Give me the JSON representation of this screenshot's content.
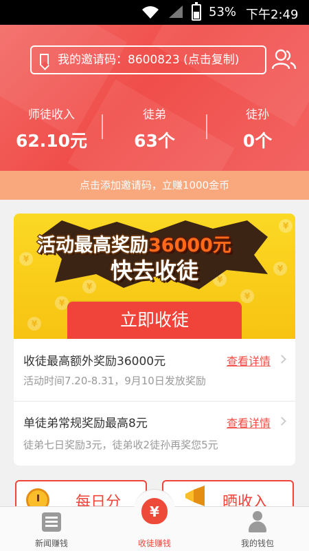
{
  "status_bar": {
    "battery": "53%",
    "time": "下午2:49"
  },
  "header": {
    "invite_text": "我的邀请码：8600823 (点击复制)",
    "stats": [
      {
        "label": "师徒收入",
        "value": "62.10元"
      },
      {
        "label": "徒弟",
        "value": "63个"
      },
      {
        "label": "徒孙",
        "value": "0个"
      }
    ],
    "promo": "点击添加邀请码，立赚1000金币"
  },
  "banner": {
    "line1_prefix": "活动最高奖励",
    "line1_amount": "36000元",
    "line2": "快去收徒",
    "button": "立即收徒"
  },
  "rewards": [
    {
      "title": "收徒最高额外奖励36000元",
      "subtitle": "活动时间7.20-8.31，9月10日发放奖励",
      "link": "查看详情"
    },
    {
      "title": "单徒弟常规奖励最高8元",
      "subtitle": "徒弟七日奖励3元，徒弟收2徒孙再奖您5元",
      "link": "查看详情"
    }
  ],
  "bottom_cards": [
    {
      "label": "每日分"
    },
    {
      "label": "晒收入"
    }
  ],
  "tabs": [
    {
      "label": "新闻赚钱",
      "icon": "news-icon"
    },
    {
      "label": "收徒赚钱",
      "icon": "money-bag-icon",
      "active": true
    },
    {
      "label": "我的钱包",
      "icon": "user-icon"
    }
  ],
  "colors": {
    "primary": "#f0443a",
    "header": "#f15551",
    "banner": "#fbd924",
    "promo": "#f9a77d"
  }
}
